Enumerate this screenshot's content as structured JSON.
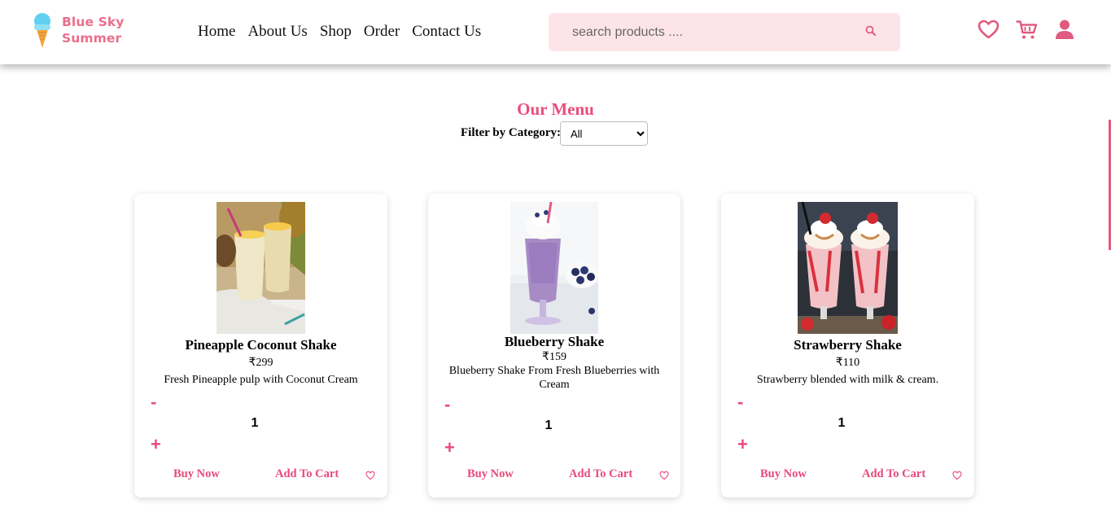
{
  "brand": {
    "line1": "Blue Sky",
    "line2": "Summer",
    "icon": "ice-cream-cone-icon",
    "colors": {
      "text": "#ea6f8c",
      "scoop": "#5fd0f0",
      "cone": "#f4a53b"
    }
  },
  "nav": {
    "items": [
      {
        "label": "Home"
      },
      {
        "label": "About Us"
      },
      {
        "label": "Shop"
      },
      {
        "label": "Order"
      },
      {
        "label": "Contact Us"
      }
    ]
  },
  "search": {
    "placeholder": "search products ....",
    "value": "",
    "icon": "search-icon"
  },
  "header_icons": [
    "heart-icon",
    "cart-icon",
    "user-icon"
  ],
  "colors": {
    "accent": "#ea4d7d",
    "search_bg": "#fde4e8",
    "icon": "#e05b7e"
  },
  "menu": {
    "title": "Our Menu",
    "filter_label": "Filter by Category:",
    "filter_selected": "All"
  },
  "products": [
    {
      "name": "Pineapple Coconut Shake",
      "price": "₹299",
      "description": "Fresh Pineapple pulp with Coconut Cream",
      "quantity": "1",
      "minus": "-",
      "plus": "+",
      "buy_label": "Buy Now",
      "cart_label": "Add To Cart",
      "wishlist_icon": "heart-outline-icon"
    },
    {
      "name": "Blueberry Shake",
      "price": "₹159",
      "description": "Blueberry Shake From Fresh Blueberries with Cream",
      "quantity": "1",
      "minus": "-",
      "plus": "+",
      "buy_label": "Buy Now",
      "cart_label": "Add To Cart",
      "wishlist_icon": "heart-outline-icon"
    },
    {
      "name": "Strawberry Shake",
      "price": "₹110",
      "description": "Strawberry blended with milk & cream.",
      "quantity": "1",
      "minus": "-",
      "plus": "+",
      "buy_label": "Buy Now",
      "cart_label": "Add To Cart",
      "wishlist_icon": "heart-outline-icon"
    }
  ]
}
